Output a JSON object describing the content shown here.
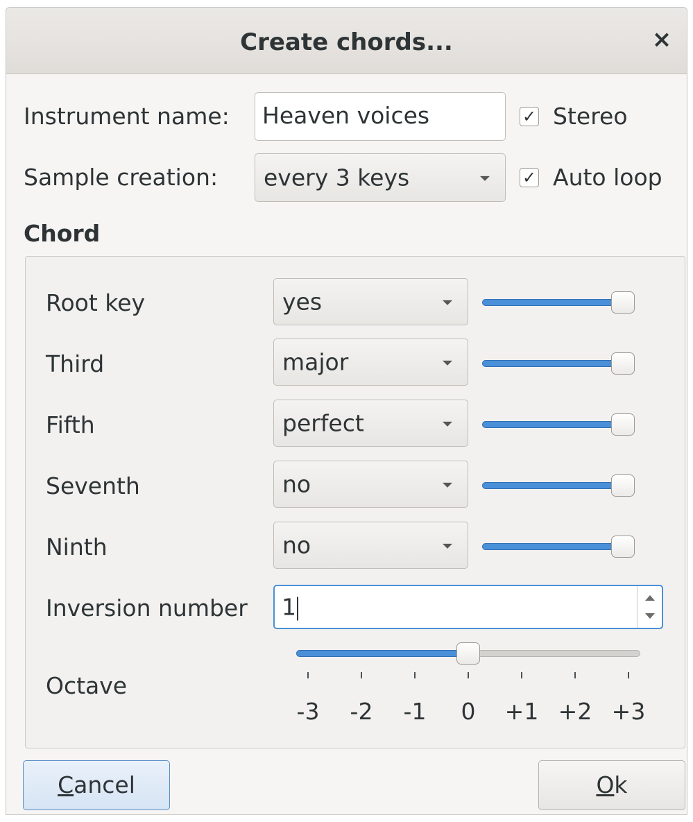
{
  "window": {
    "title": "Create chords...",
    "close_glyph": "×"
  },
  "form": {
    "instrument_name_label": "Instrument name:",
    "instrument_name_value": "Heaven voices",
    "stereo_label": "Stereo",
    "stereo_checked": true,
    "sample_creation_label": "Sample creation:",
    "sample_creation_value": "every 3 keys",
    "auto_loop_label": "Auto loop",
    "auto_loop_checked": true,
    "check_glyph": "✓"
  },
  "chord": {
    "section_label": "Chord",
    "rows": [
      {
        "label": "Root key",
        "value": "yes",
        "slider_level": 1.0
      },
      {
        "label": "Third",
        "value": "major",
        "slider_level": 1.0
      },
      {
        "label": "Fifth",
        "value": "perfect",
        "slider_level": 1.0
      },
      {
        "label": "Seventh",
        "value": "no",
        "slider_level": 1.0
      },
      {
        "label": "Ninth",
        "value": "no",
        "slider_level": 1.0
      }
    ],
    "inversion_label": "Inversion number",
    "inversion_value": "1",
    "octave_label": "Octave",
    "octave_value": 0,
    "octave_ticks": [
      "-3",
      "-2",
      "-1",
      "0",
      "+1",
      "+2",
      "+3"
    ]
  },
  "buttons": {
    "cancel_mnemonic": "C",
    "cancel_rest": "ancel",
    "ok_mnemonic": "O",
    "ok_rest": "k"
  },
  "colors": {
    "accent": "#4a90d9",
    "window_bg": "#f6f5f4",
    "titlebar_bg": "#e0ddd9"
  }
}
